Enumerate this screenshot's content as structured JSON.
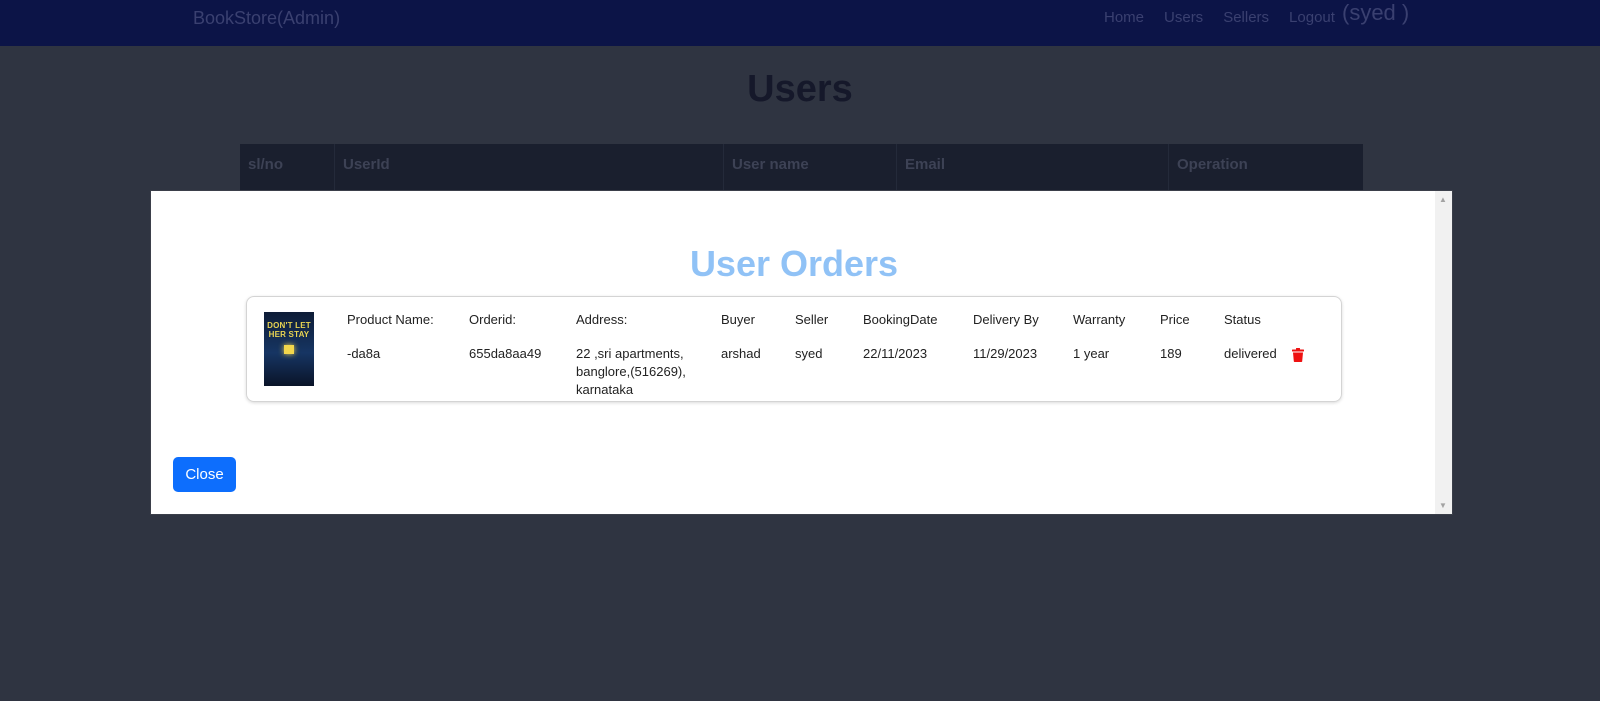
{
  "navbar": {
    "brand": "BookStore(Admin)",
    "links": [
      "Home",
      "Users",
      "Sellers",
      "Logout"
    ],
    "user": "(syed )"
  },
  "page": {
    "title": "Users",
    "table_headers": [
      "sl/no",
      "UserId",
      "User name",
      "Email",
      "Operation"
    ]
  },
  "modal": {
    "title": "User Orders",
    "close_label": "Close",
    "order": {
      "cover_text": "DON'T LET HER STAY",
      "product_name_label": "Product Name:",
      "product_name": "-da8a",
      "orderid_label": "Orderid:",
      "orderid": "655da8aa49",
      "address_label": "Address:",
      "address_lines": [
        "22 ,sri apartments,",
        "banglore,(516269),",
        "karnataka"
      ],
      "buyer_label": "Buyer",
      "buyer": "arshad",
      "seller_label": "Seller",
      "seller": "syed",
      "booking_date_label": "BookingDate",
      "booking_date": "22/11/2023",
      "delivery_label": "Delivery By",
      "delivery": "11/29/2023",
      "warranty_label": "Warranty",
      "warranty": "1 year",
      "price_label": "Price",
      "price": "189",
      "status_label": "Status",
      "status": "delivered"
    }
  },
  "colors": {
    "navbar": "#0c1447",
    "backdrop": "#2f3441",
    "modal_title": "#90c2f6",
    "close_button": "#0d6efd",
    "delete_icon": "#ee1111"
  }
}
